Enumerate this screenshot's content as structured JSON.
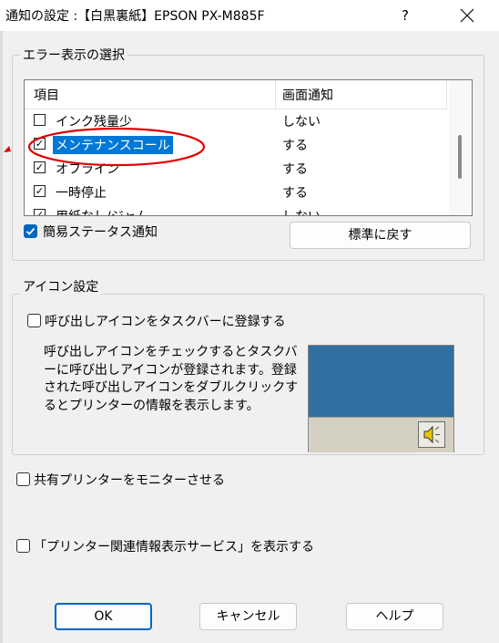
{
  "window": {
    "title": "通知の設定 :【白黒裏紙】EPSON PX-M885F",
    "help_glyph": "?",
    "close_glyph": "✕"
  },
  "error_group": {
    "label": "エラー表示の選択",
    "columns": [
      "項目",
      "画面通知"
    ],
    "rows": [
      {
        "name": "インク残量少",
        "checked": false,
        "value": "しない"
      },
      {
        "name": "メンテナンスコール",
        "checked": true,
        "value": "する",
        "selected": true
      },
      {
        "name": "オフライン",
        "checked": true,
        "value": "する"
      },
      {
        "name": "一時停止",
        "checked": true,
        "value": "する"
      },
      {
        "name": "用紙なし/ジャム",
        "checked": true,
        "value": "しない"
      }
    ],
    "simple_status": {
      "label": "簡易ステータス通知",
      "checked": true
    },
    "reset_button": "標準に戻す"
  },
  "icon_group": {
    "label": "アイコン設定",
    "register_checkbox": {
      "label": "呼び出しアイコンをタスクバーに登録する",
      "checked": false
    },
    "description": "呼び出しアイコンをチェックするとタスクバーに呼び出しアイコンが登録されます。登録された呼び出しアイコンをダブルクリックするとプリンターの情報を表示します。",
    "speaker_icon": "speaker-icon"
  },
  "shared_printer": {
    "label": "共有プリンターをモニターさせる",
    "checked": false
  },
  "info_service": {
    "label": "「プリンター関連情報表示サービス」を表示する",
    "checked": false
  },
  "buttons": {
    "ok": "OK",
    "cancel": "キャンセル",
    "help": "ヘルプ"
  },
  "colors": {
    "accent": "#0067c0",
    "annotation": "#e00000",
    "selection": "#0078d7"
  }
}
